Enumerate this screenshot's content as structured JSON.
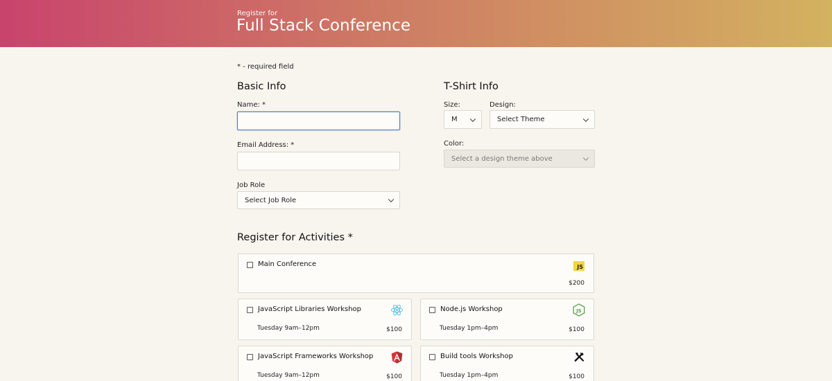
{
  "header": {
    "subtitle": "Register for",
    "title": "Full Stack Conference"
  },
  "required_note": "* - required field",
  "basic_info": {
    "heading": "Basic Info",
    "name_label": "Name: *",
    "email_label": "Email Address: *",
    "job_label": "Job Role",
    "job_value": "Select Job Role"
  },
  "tshirt": {
    "heading": "T-Shirt Info",
    "size_label": "Size:",
    "size_value": "M",
    "design_label": "Design:",
    "design_value": "Select Theme",
    "color_label": "Color:",
    "color_value": "Select a design theme above"
  },
  "activities": {
    "heading": "Register for Activities *",
    "items": [
      {
        "name": "Main Conference",
        "time": "",
        "cost": "$200",
        "icon": "javascript-icon",
        "checked": false
      },
      {
        "name": "JavaScript Libraries Workshop",
        "time": "Tuesday 9am–12pm",
        "cost": "$100",
        "icon": "react-icon",
        "checked": false
      },
      {
        "name": "Node.js Workshop",
        "time": "Tuesday 1pm–4pm",
        "cost": "$100",
        "icon": "nodejs-icon",
        "checked": false
      },
      {
        "name": "JavaScript Frameworks Workshop",
        "time": "Tuesday 9am–12pm",
        "cost": "$100",
        "icon": "angular-icon",
        "checked": false
      },
      {
        "name": "Build tools Workshop",
        "time": "Tuesday 1pm–4pm",
        "cost": "$100",
        "icon": "tools-icon",
        "checked": false
      }
    ]
  },
  "colors": {
    "header_gradient_start": "#c9436d",
    "header_gradient_end": "#d3b260",
    "background": "#f8f5ef",
    "focus_border": "#4a7fd6"
  }
}
